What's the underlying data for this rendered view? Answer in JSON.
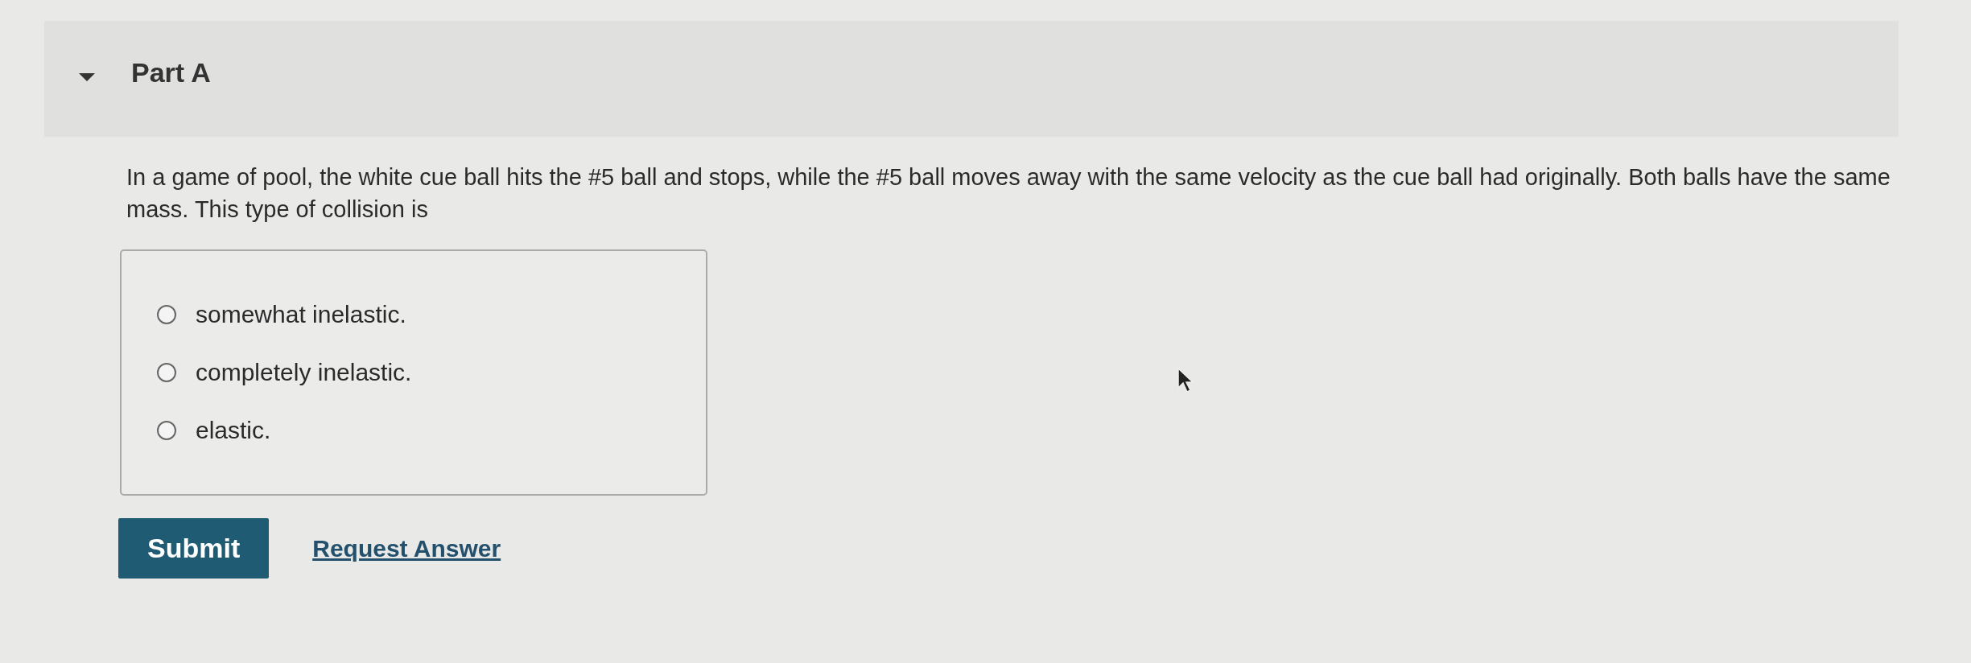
{
  "part": {
    "title": "Part A",
    "expanded": true
  },
  "question": "In a game of pool, the white cue ball hits the #5 ball and stops, while the #5 ball moves away with the same velocity as the cue ball had originally. Both balls have the same mass. This type of collision is",
  "options": [
    {
      "label": "somewhat inelastic.",
      "selected": false
    },
    {
      "label": "completely inelastic.",
      "selected": false
    },
    {
      "label": "elastic.",
      "selected": false
    }
  ],
  "buttons": {
    "submit": "Submit",
    "request": "Request Answer"
  }
}
